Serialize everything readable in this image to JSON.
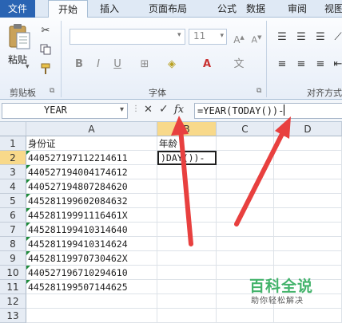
{
  "ribbon": {
    "tabs": [
      "文件",
      "开始",
      "插入",
      "页面布局",
      "公式",
      "数据",
      "审阅",
      "视图"
    ],
    "paste_label": "粘贴",
    "clipboard_label": "剪贴板",
    "font_label": "字体",
    "font_size": "11",
    "align_label": "对齐方式"
  },
  "formula_bar": {
    "name_box": "YEAR",
    "fx_label": "fx",
    "formula": "=YEAR(TODAY())-"
  },
  "sheet": {
    "columns": [
      "A",
      "B",
      "C",
      "D"
    ],
    "rows": [
      "1",
      "2",
      "3",
      "4",
      "5",
      "6",
      "7",
      "8",
      "9",
      "10",
      "11",
      "12",
      "13"
    ],
    "a1": "身份证",
    "b1": "年龄",
    "b2_edit": ")DAY())-",
    "ids": [
      "440527197112214611",
      "440527194004174612",
      "440527194807284620",
      "445281199602084632",
      "44528119991116461X",
      "445281199410314640",
      "445281199410314624",
      "44528119970730462X",
      "440527196710294610",
      "445281199507144625"
    ]
  },
  "watermark": {
    "title": "百科全说",
    "subtitle": "助你轻松解决"
  },
  "colors": {
    "file_tab": "#2a64b3",
    "selection_header": "#f8d98a",
    "arrow": "#e8403f",
    "watermark": "#43b36b"
  }
}
